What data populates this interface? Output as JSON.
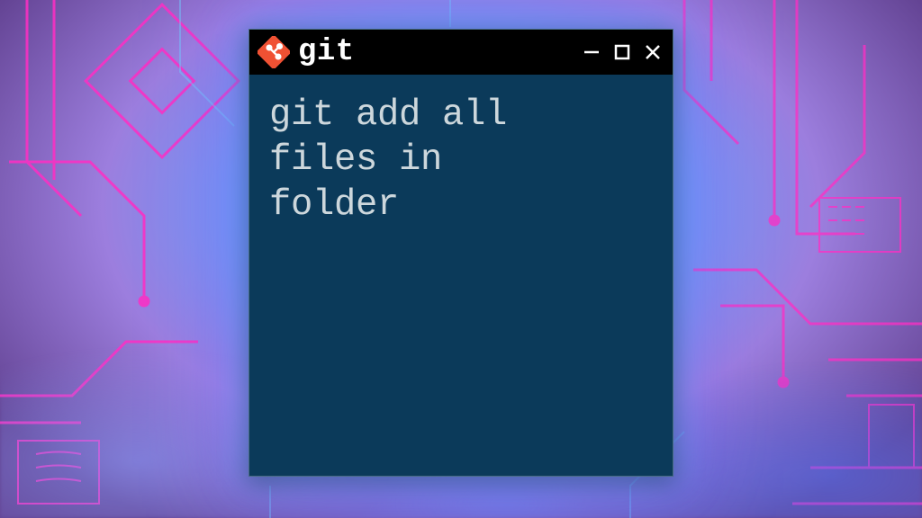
{
  "window": {
    "app_name": "git",
    "icon_name": "git-icon",
    "icon_color": "#f05133",
    "titlebar_bg": "#000000",
    "body_bg": "#0b3a5a",
    "text_color": "#cdd7dc"
  },
  "terminal": {
    "content": "git add all\nfiles in\nfolder"
  },
  "controls": {
    "minimize": "−",
    "maximize": "□",
    "close": "×"
  }
}
